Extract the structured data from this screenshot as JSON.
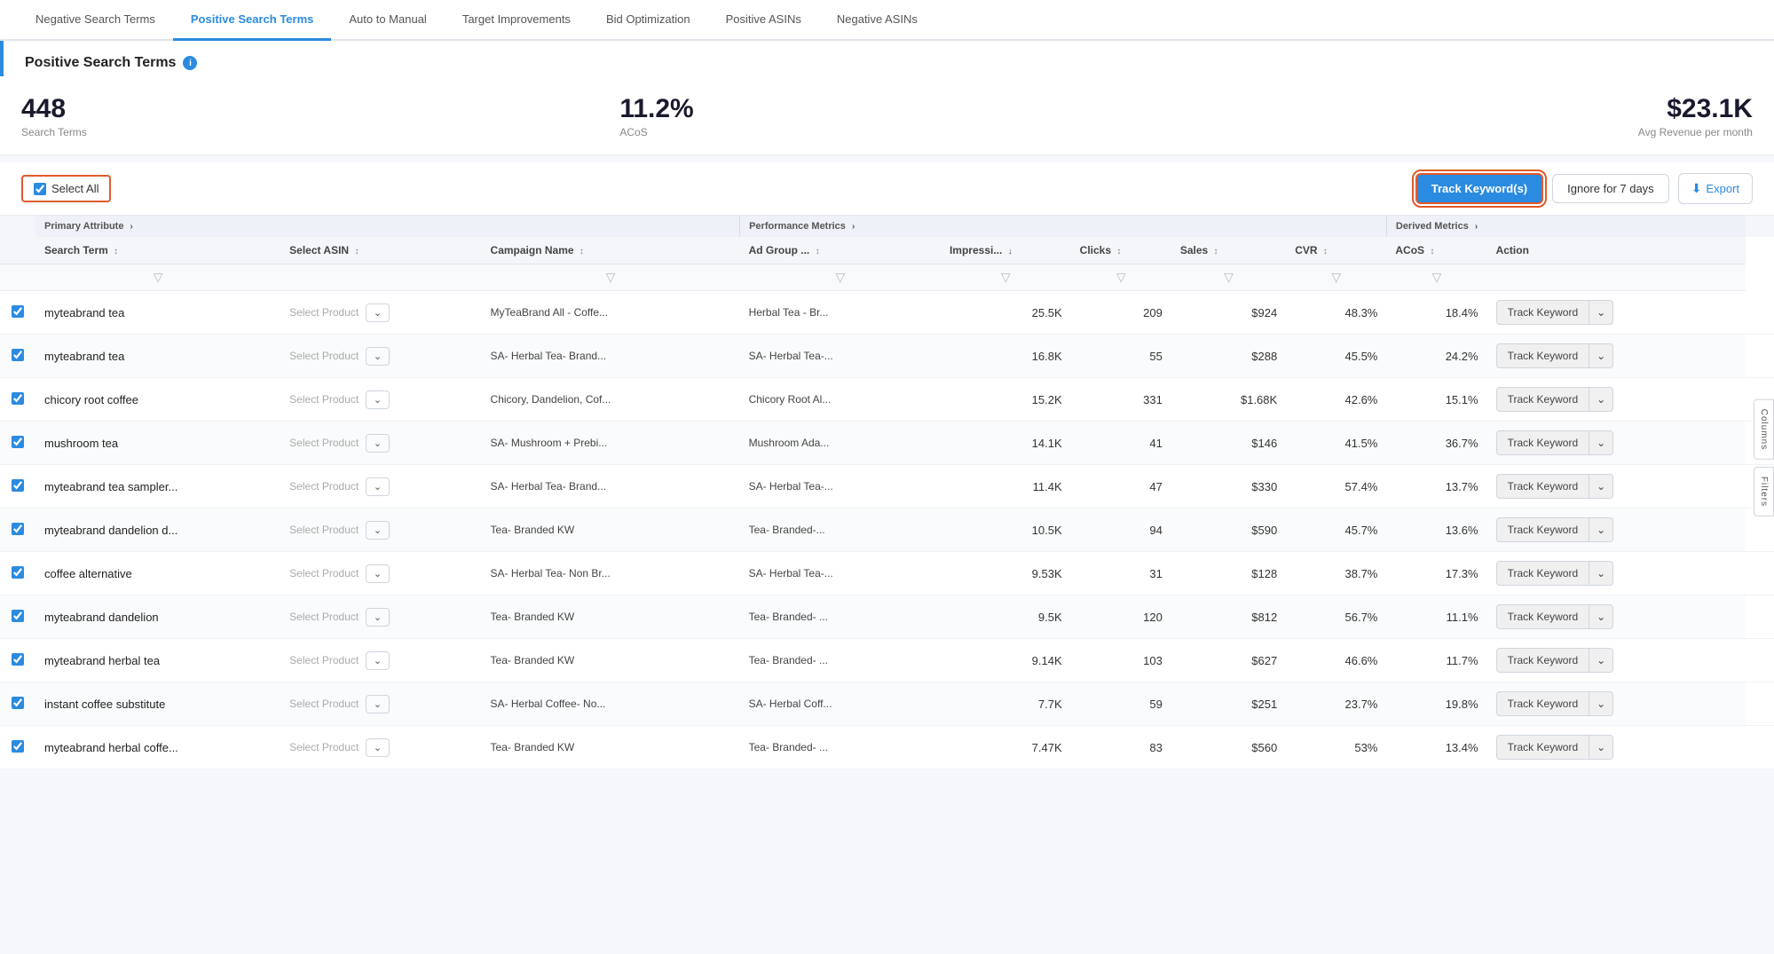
{
  "tabs": [
    {
      "label": "Negative Search Terms",
      "active": false
    },
    {
      "label": "Positive Search Terms",
      "active": true
    },
    {
      "label": "Auto to Manual",
      "active": false
    },
    {
      "label": "Target Improvements",
      "active": false
    },
    {
      "label": "Bid Optimization",
      "active": false
    },
    {
      "label": "Positive ASINs",
      "active": false
    },
    {
      "label": "Negative ASINs",
      "active": false
    }
  ],
  "page_title": "Positive Search Terms",
  "metrics": [
    {
      "value": "448",
      "label": "Search Terms"
    },
    {
      "value": "11.2%",
      "label": "ACoS"
    },
    {
      "value": "$23.1K",
      "label": "Avg Revenue per month"
    }
  ],
  "toolbar": {
    "select_all": "Select All",
    "track_keywords_btn": "Track Keyword(s)",
    "ignore_btn": "Ignore for 7 days",
    "export_btn": "Export"
  },
  "group_headers": {
    "primary": "Primary Attribute",
    "performance": "Performance Metrics",
    "derived": "Derived Metrics"
  },
  "column_headers": [
    {
      "label": "Search Term",
      "sortable": true
    },
    {
      "label": "Select ASIN",
      "sortable": true
    },
    {
      "label": "Campaign Name",
      "sortable": true
    },
    {
      "label": "Ad Group ...",
      "sortable": true
    },
    {
      "label": "Impressi...",
      "sortable": true,
      "sort_dir": "desc"
    },
    {
      "label": "Clicks",
      "sortable": true
    },
    {
      "label": "Sales",
      "sortable": true
    },
    {
      "label": "CVR",
      "sortable": true
    },
    {
      "label": "ACoS",
      "sortable": true
    },
    {
      "label": "Action",
      "sortable": false
    }
  ],
  "rows": [
    {
      "checked": true,
      "search_term": "myteabrand tea",
      "select_asin": "Select Product",
      "campaign": "MyTeaBrand All - Coffe...",
      "ad_group": "Herbal Tea - Br...",
      "impressions": "25.5K",
      "clicks": "209",
      "sales": "$924",
      "cvr": "48.3%",
      "acos": "18.4%",
      "action": "Track Keyword"
    },
    {
      "checked": true,
      "search_term": "myteabrand tea",
      "select_asin": "Select Product",
      "campaign": "SA- Herbal Tea- Brand...",
      "ad_group": "SA- Herbal Tea-...",
      "impressions": "16.8K",
      "clicks": "55",
      "sales": "$288",
      "cvr": "45.5%",
      "acos": "24.2%",
      "action": "Track Keyword"
    },
    {
      "checked": true,
      "search_term": "chicory root coffee",
      "select_asin": "Select Product",
      "campaign": "Chicory, Dandelion, Cof...",
      "ad_group": "Chicory Root Al...",
      "impressions": "15.2K",
      "clicks": "331",
      "sales": "$1.68K",
      "cvr": "42.6%",
      "acos": "15.1%",
      "action": "Track Keyword"
    },
    {
      "checked": true,
      "search_term": "mushroom tea",
      "select_asin": "Select Product",
      "campaign": "SA- Mushroom + Prebi...",
      "ad_group": "Mushroom Ada...",
      "impressions": "14.1K",
      "clicks": "41",
      "sales": "$146",
      "cvr": "41.5%",
      "acos": "36.7%",
      "action": "Track Keyword"
    },
    {
      "checked": true,
      "search_term": "myteabrand tea sampler...",
      "select_asin": "Select Product",
      "campaign": "SA- Herbal Tea- Brand...",
      "ad_group": "SA- Herbal Tea-...",
      "impressions": "11.4K",
      "clicks": "47",
      "sales": "$330",
      "cvr": "57.4%",
      "acos": "13.7%",
      "action": "Track Keyword"
    },
    {
      "checked": true,
      "search_term": "myteabrand dandelion d...",
      "select_asin": "Select Product",
      "campaign": "Tea- Branded KW",
      "ad_group": "Tea- Branded-...",
      "impressions": "10.5K",
      "clicks": "94",
      "sales": "$590",
      "cvr": "45.7%",
      "acos": "13.6%",
      "action": "Track Keyword"
    },
    {
      "checked": true,
      "search_term": "coffee alternative",
      "select_asin": "Select Product",
      "campaign": "SA- Herbal Tea- Non Br...",
      "ad_group": "SA- Herbal Tea-...",
      "impressions": "9.53K",
      "clicks": "31",
      "sales": "$128",
      "cvr": "38.7%",
      "acos": "17.3%",
      "action": "Track Keyword"
    },
    {
      "checked": true,
      "search_term": "myteabrand dandelion",
      "select_asin": "Select Product",
      "campaign": "Tea- Branded KW",
      "ad_group": "Tea- Branded- ...",
      "impressions": "9.5K",
      "clicks": "120",
      "sales": "$812",
      "cvr": "56.7%",
      "acos": "11.1%",
      "action": "Track Keyword"
    },
    {
      "checked": true,
      "search_term": "myteabrand herbal tea",
      "select_asin": "Select Product",
      "campaign": "Tea- Branded KW",
      "ad_group": "Tea- Branded- ...",
      "impressions": "9.14K",
      "clicks": "103",
      "sales": "$627",
      "cvr": "46.6%",
      "acos": "11.7%",
      "action": "Track Keyword"
    },
    {
      "checked": true,
      "search_term": "instant coffee substitute",
      "select_asin": "Select Product",
      "campaign": "SA- Herbal Coffee- No...",
      "ad_group": "SA- Herbal Coff...",
      "impressions": "7.7K",
      "clicks": "59",
      "sales": "$251",
      "cvr": "23.7%",
      "acos": "19.8%",
      "action": "Track Keyword"
    },
    {
      "checked": true,
      "search_term": "myteabrand herbal coffe...",
      "select_asin": "Select Product",
      "campaign": "Tea- Branded KW",
      "ad_group": "Tea- Branded- ...",
      "impressions": "7.47K",
      "clicks": "83",
      "sales": "$560",
      "cvr": "53%",
      "acos": "13.4%",
      "action": "Track Keyword"
    }
  ],
  "side_btns": {
    "columns": "Columns",
    "filters": "Filters"
  }
}
